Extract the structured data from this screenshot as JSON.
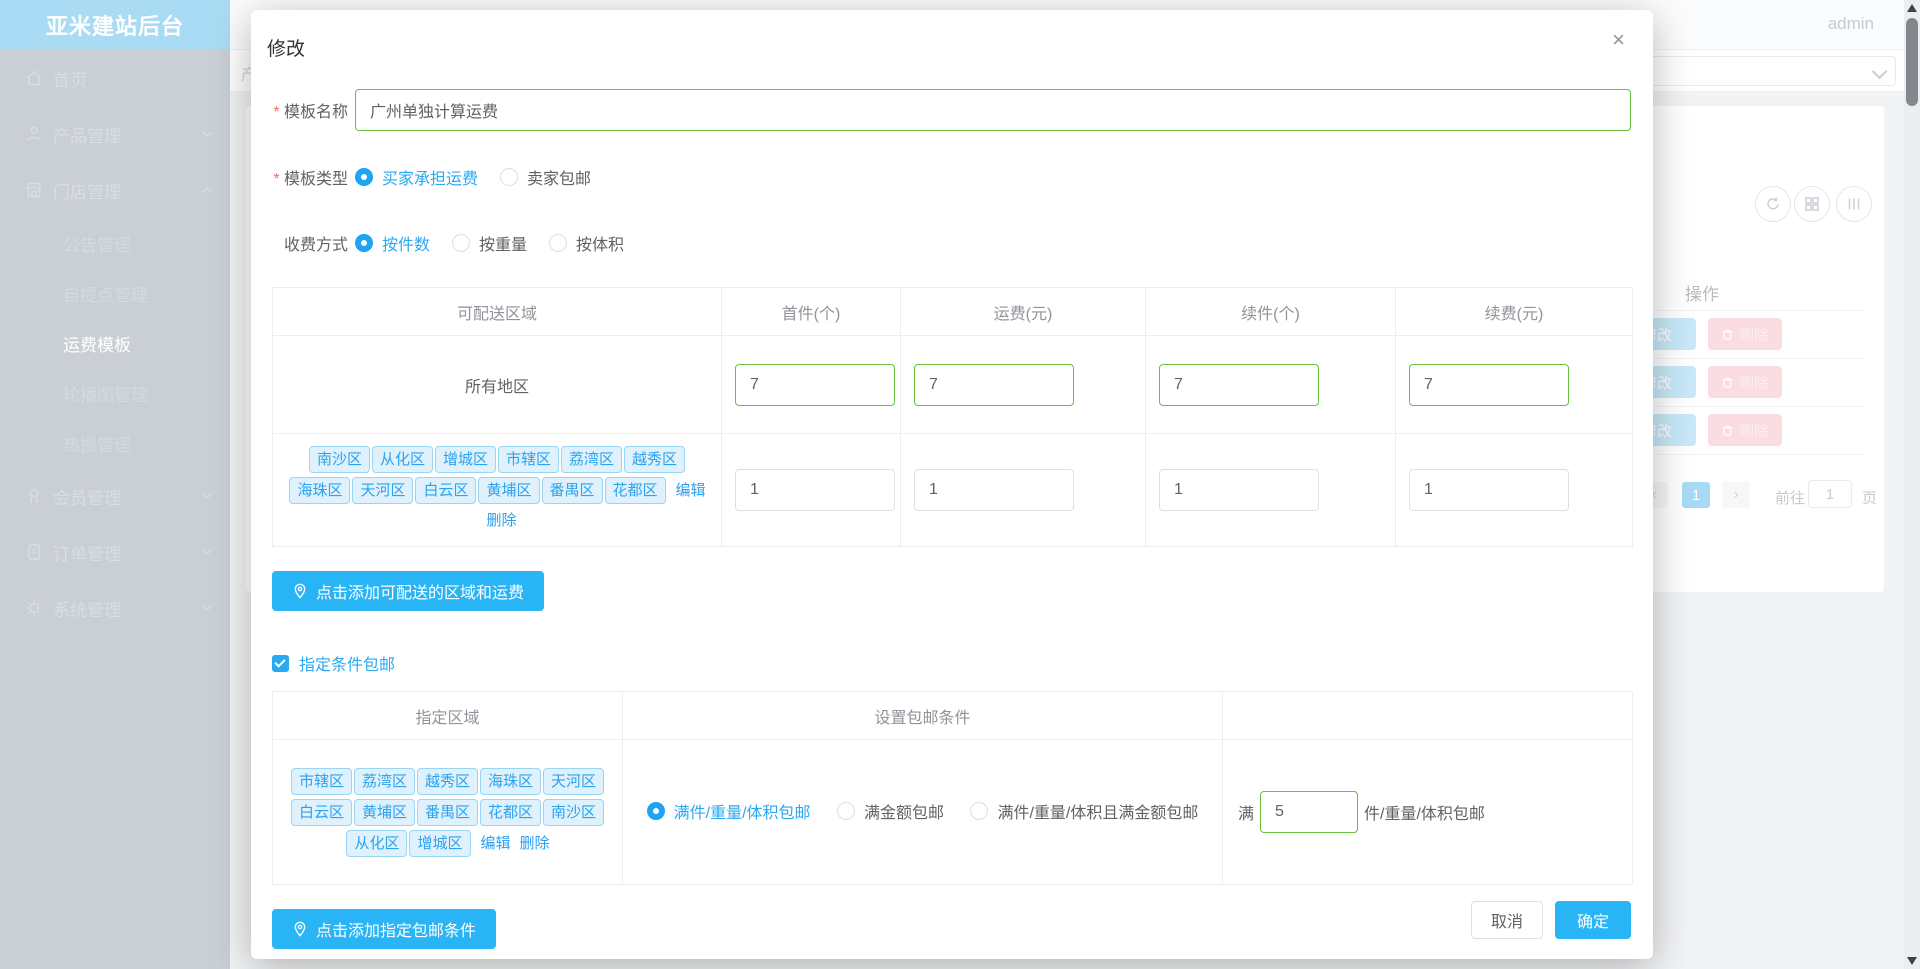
{
  "colors": {
    "primary_blue": "#2aa9f0",
    "button_blue": "#29b4f6",
    "success_green": "#67c23a",
    "sidebar_header_blue": "#a9dcf4",
    "tag_bg": "#def1fc",
    "washed_edit_bg": "#c8e8f9",
    "washed_delete_bg": "#fbdce1"
  },
  "sidebar": {
    "brand": "亚米建站后台",
    "items": [
      {
        "label": "首页"
      },
      {
        "label": "产品管理"
      },
      {
        "label": "门店管理"
      },
      {
        "label": "会员管理"
      },
      {
        "label": "订单管理"
      },
      {
        "label": "系统管理"
      }
    ],
    "store_children": [
      {
        "label": "公告管理"
      },
      {
        "label": "自提点管理"
      },
      {
        "label": "运费模板"
      },
      {
        "label": "轮播图管理"
      },
      {
        "label": "热搜管理"
      }
    ]
  },
  "topbar": {
    "username": "admin",
    "breadcrumb_fragment": "产"
  },
  "background": {
    "ops_header": "操作",
    "edit_label": "修改",
    "delete_label": "删除",
    "pagination": {
      "prev": "‹",
      "active_page": "1",
      "next": "›",
      "goto_label": "前往",
      "goto_value": "1",
      "page_unit": "页"
    }
  },
  "modal": {
    "title": "修改",
    "close_label": "×",
    "name_field": {
      "label": "模板名称",
      "value": "广州单独计算运费"
    },
    "type_field": {
      "label": "模板类型",
      "options": [
        {
          "label": "买家承担运费",
          "checked": true
        },
        {
          "label": "卖家包邮",
          "checked": false
        }
      ]
    },
    "charge_field": {
      "label": "收费方式",
      "options": [
        {
          "label": "按件数",
          "checked": true
        },
        {
          "label": "按重量",
          "checked": false
        },
        {
          "label": "按体积",
          "checked": false
        }
      ]
    },
    "shipping_table": {
      "headers": [
        "可配送区域",
        "首件(个)",
        "运费(元)",
        "续件(个)",
        "续费(元)"
      ],
      "row_all": {
        "region": "所有地区",
        "values": [
          "7",
          "7",
          "7",
          "7"
        ]
      },
      "row_custom": {
        "tags": [
          "南沙区",
          "从化区",
          "增城区",
          "市辖区",
          "荔湾区",
          "越秀区",
          "海珠区",
          "天河区",
          "白云区",
          "黄埔区",
          "番禺区",
          "花都区"
        ],
        "edit_link": "编辑",
        "delete_link": "删除",
        "values": [
          "1",
          "1",
          "1",
          "1"
        ]
      }
    },
    "add_region_button": "点击添加可配送的区域和运费",
    "free_condition_checkbox": "指定条件包邮",
    "condition_table": {
      "headers": [
        "指定区域",
        "设置包邮条件",
        ""
      ],
      "row": {
        "tags": [
          "市辖区",
          "荔湾区",
          "越秀区",
          "海珠区",
          "天河区",
          "白云区",
          "黄埔区",
          "番禺区",
          "花都区",
          "南沙区",
          "从化区",
          "增城区"
        ],
        "edit_link": "编辑",
        "delete_link": "删除",
        "options": [
          {
            "label": "满件/重量/体积包邮",
            "checked": true
          },
          {
            "label": "满金额包邮",
            "checked": false
          },
          {
            "label": "满件/重量/体积且满金额包邮",
            "checked": false
          }
        ],
        "threshold_prefix": "满",
        "threshold_value": "5",
        "threshold_suffix": "件/重量/体积包邮"
      }
    },
    "add_condition_button": "点击添加指定包邮条件",
    "footer": {
      "cancel": "取消",
      "confirm": "确定"
    }
  }
}
